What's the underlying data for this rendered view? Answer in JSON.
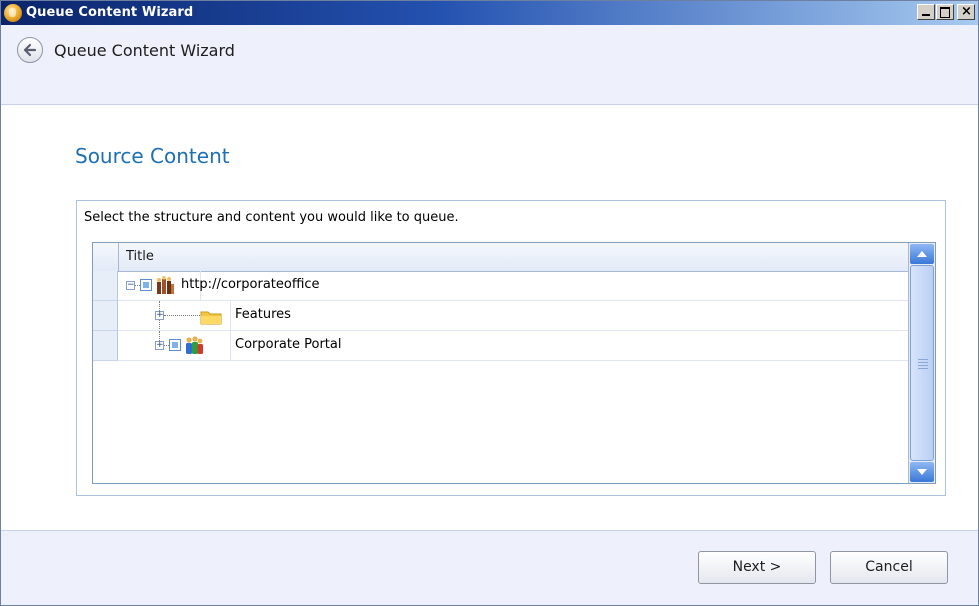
{
  "window": {
    "title": "Queue Content Wizard",
    "controls": {
      "minimize": "_",
      "maximize": "□",
      "close": "×"
    }
  },
  "header": {
    "title": "Queue Content Wizard",
    "back_icon": "back-arrow-icon"
  },
  "page": {
    "title": "Source Content",
    "instruction": "Select the structure and content you would like to queue."
  },
  "tree_grid": {
    "column_title": "Title",
    "nodes": [
      {
        "label": "http://corporateoffice",
        "icon": "site-collection-icon",
        "checkbox": true,
        "expanded": true,
        "level": 0
      },
      {
        "label": "Features",
        "icon": "folder-icon",
        "checkbox": false,
        "expanded": false,
        "level": 1
      },
      {
        "label": "Corporate Portal",
        "icon": "site-people-icon",
        "checkbox": true,
        "expanded": false,
        "level": 1
      }
    ]
  },
  "footer": {
    "next_label": "Next >",
    "cancel_label": "Cancel"
  },
  "colors": {
    "accent_title": "#1f6fb4",
    "titlebar_start": "#0a246a",
    "panel_border": "#a9c4e0"
  }
}
